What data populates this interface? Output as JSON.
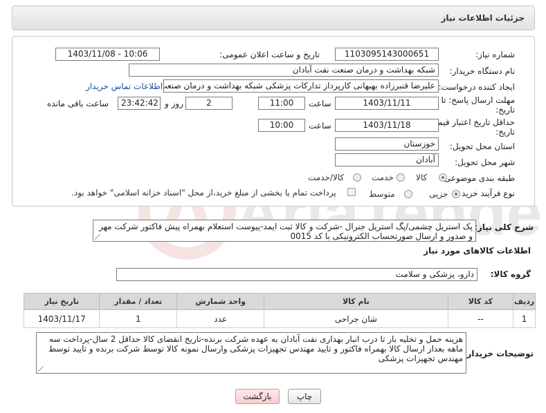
{
  "header": {
    "title": "جزئیات اطلاعات نیاز"
  },
  "form": {
    "need_number": {
      "label": "شماره نیاز:",
      "value": "1103095143000651"
    },
    "announce_datetime": {
      "label": "تاریخ و ساعت اعلان عمومی:",
      "value": "1403/11/08 - 10:06"
    },
    "buyer_org": {
      "label": "نام دستگاه خریدار:",
      "value": "شبکه بهداشت و درمان صنعت نفت آبادان"
    },
    "requester": {
      "label": "ایجاد کننده درخواست:",
      "value": "علیرضا قنبرزاده بهبهانی کارپرداز تدارکات پزشکی شبکه بهداشت و درمان صنعت",
      "contact_link": "اطلاعات تماس خریدار"
    },
    "response_deadline": {
      "label_line1": "مهلت ارسال پاسخ: تا",
      "label_line2": "تاریخ:",
      "date": "1403/11/11",
      "time_label": "ساعت",
      "time": "11:00",
      "days": "2",
      "days_label": "روز و",
      "remaining": "23:42:42",
      "remaining_label": "ساعت باقی مانده"
    },
    "price_validity": {
      "label_line1": "حداقل تاریخ اعتبار قیمت: تا",
      "label_line2": "تاریخ:",
      "date": "1403/11/18",
      "time_label": "ساعت",
      "time": "10:00"
    },
    "province": {
      "label": "استان محل تحویل:",
      "value": "خوزستان"
    },
    "city": {
      "label": "شهر محل تحویل:",
      "value": "آبادان"
    },
    "category": {
      "label": "طبقه بندی موضوعی:",
      "options": [
        "کالا",
        "خدمت",
        "کالا/خدمت"
      ],
      "selected": "کالا"
    },
    "purchase_type": {
      "label": "نوع فرآیند خرید :",
      "options": [
        "جزیی",
        "متوسط"
      ],
      "selected": "جزیی",
      "checkbox_text": "پرداخت تمام یا بخشی از مبلغ خرید،از محل \"اسناد خزانه اسلامی\" خواهد بود."
    }
  },
  "summary": {
    "label": "شرح کلی نیاز:",
    "text": "پک استریل چشمی/پگ استریل جنرال -شرکت و کالا ثبت ایمد-پیوست استعلام بهمراه پیش فاکتور شرکت مهر و صدور و ارسال صورتحساب الکترونیکی با کد 0015"
  },
  "goods_info_title": "اطلاعات کالاهای مورد نیاز",
  "goods_group": {
    "label": "گروه کالا:",
    "value": "دارو، پزشکی و سلامت"
  },
  "table": {
    "columns": [
      "ردیف",
      "کد کالا",
      "نام کالا",
      "واحد شمارش",
      "تعداد / مقدار",
      "تاریخ نیاز"
    ],
    "rows": [
      [
        "1",
        "--",
        "شان جراحی",
        "عدد",
        "1",
        "1403/11/17"
      ]
    ]
  },
  "buyer_notes": {
    "label": "توضیحات خریدار:",
    "text": "هزینه حمل و تخلیه بار تا درب انبار بهداری نفت آبادان به عهده شرکت برنده-تاریخ انقضای کالا حداقل 2 سال-پرداخت سه ماهه بعداز ارسال کالا بهمراه فاکتور و تایید مهندس تجهیزات پزشکی وارسال نمونه کالا توسط شرکت برنده و تایید توسط مهندس تجهیزات پزشکی"
  },
  "buttons": {
    "print": "چاپ",
    "back": "بازگشت"
  },
  "watermark": {
    "text": "AriaTender.neT"
  }
}
